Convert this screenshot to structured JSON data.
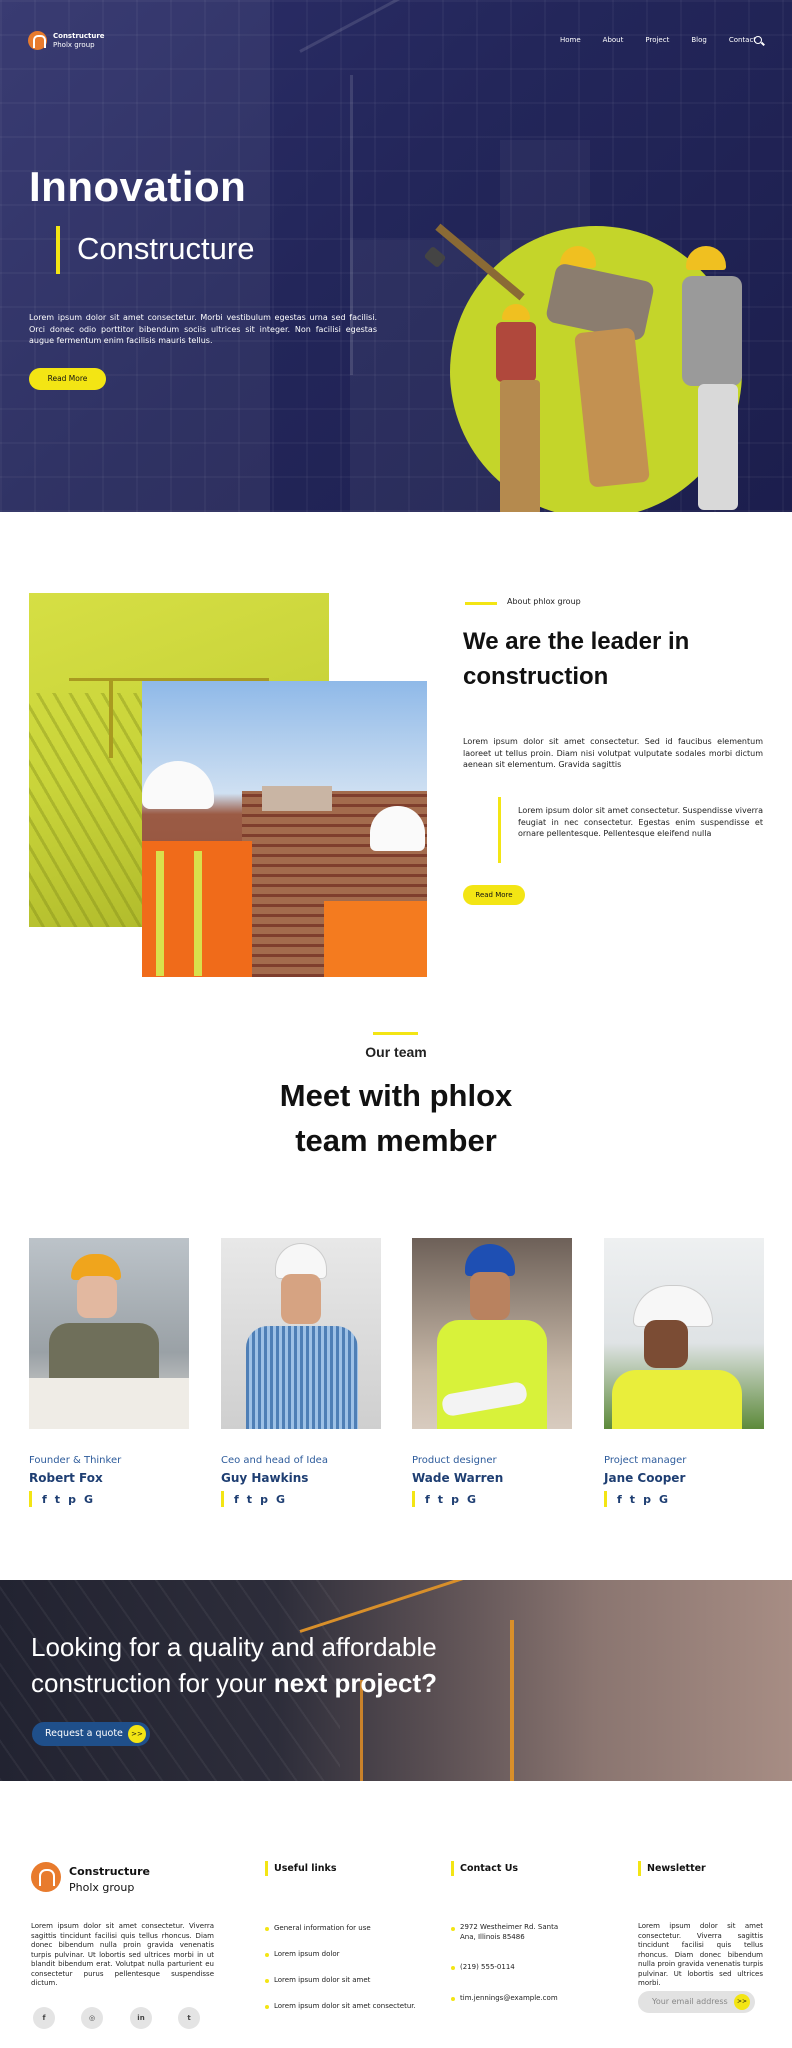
{
  "brand": {
    "name": "Constructure",
    "tagline": "Pholx group"
  },
  "nav": {
    "items": [
      "Home",
      "About",
      "Project",
      "Blog",
      "Contact"
    ]
  },
  "hero": {
    "title": "Innovation",
    "subtitle": "Constructure",
    "paragraph": "Lorem ipsum dolor sit amet consectetur. Morbi vestibulum egestas urna sed facilisi. Orci donec odio porttitor bibendum sociis ultrices sit integer. Non facilisi egestas augue fermentum enim facilisis mauris tellus.",
    "button": "Read More"
  },
  "about": {
    "small_label": "About phlox group",
    "heading": "We are the leader in construction",
    "paragraph": "Lorem ipsum dolor sit amet consectetur. Sed id faucibus elementum laoreet ut tellus proin. Diam nisi volutpat vulputate sodales morbi dictum aenean sit elementum. Gravida sagittis",
    "quote": "Lorem ipsum dolor sit amet consectetur. Suspendisse viverra feugiat in nec consectetur. Egestas enim suspendisse et ornare pellentesque. Pellentesque eleifend nulla",
    "button": "Read More"
  },
  "team": {
    "small_label": "Our team",
    "heading": "Meet with phlox team member",
    "members": [
      {
        "role": "Founder & Thinker",
        "name": "Robert Fox"
      },
      {
        "role": "Ceo and head of Idea",
        "name": "Guy Hawkins"
      },
      {
        "role": "Product designer",
        "name": "Wade Warren"
      },
      {
        "role": "Project manager",
        "name": "Jane Cooper"
      }
    ]
  },
  "cta": {
    "line1": "Looking for a quality and affordable",
    "line2_prefix": "construction for your ",
    "line2_bold": "next project?",
    "button": "Request a quote",
    "button_arrow": ">>"
  },
  "footer": {
    "brand_name": "Constructure",
    "brand_tag": "Pholx group",
    "paragraph": "Lorem ipsum dolor sit amet consectetur. Viverra sagittis tincidunt facilisi quis tellus rhoncus. Diam donec bibendum nulla proin gravida venenatis turpis pulvinar. Ut lobortis sed ultrices morbi in ut blandit bibendum erat. Volutpat nulla parturient eu consectetur purus pellentesque suspendisse dictum.",
    "useful_title": "Useful links",
    "useful_links": [
      "General information for use",
      "Lorem ipsum dolor",
      "Lorem ipsum dolor sit amet",
      "Lorem ipsum dolor sit amet consectetur."
    ],
    "contact_title": "Contact Us",
    "contact_address": "2972 Westheimer Rd. Santa Ana, Illinois 85486",
    "contact_phone": "(219) 555-0114",
    "contact_email": "tim.jennings@example.com",
    "news_title": "Newsletter",
    "news_paragraph": "Lorem ipsum dolor sit amet consectetur. Viverra sagittis tincidunt facilisi quis tellus rhoncus. Diam donec bibendum nulla proin gravida venenatis turpis pulvinar. Ut lobortis sed ultrices morbi.",
    "email_placeholder": "Your email address",
    "email_arrow": ">>"
  },
  "colors": {
    "accent": "#f3e514",
    "navy": "#23265a",
    "brand": "#e87b2d",
    "link": "#1e3e72"
  }
}
